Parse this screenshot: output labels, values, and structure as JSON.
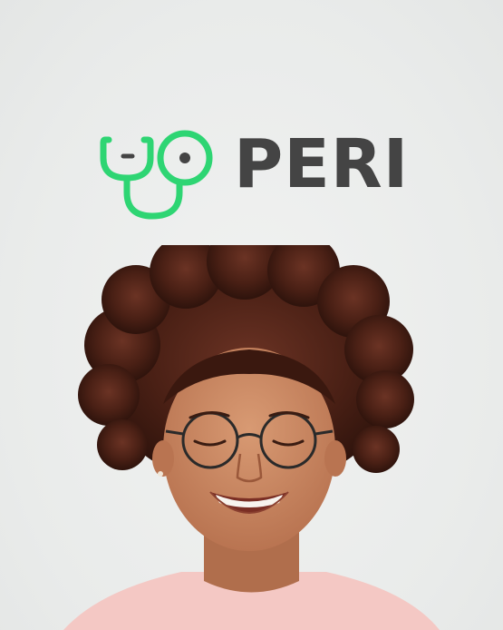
{
  "brand": {
    "name": "PERI",
    "accent_color": "#2ed573",
    "text_color": "#444444",
    "mark_icon": "stethoscope-icon"
  },
  "hero": {
    "image": "smiling-woman-glasses-photo"
  }
}
